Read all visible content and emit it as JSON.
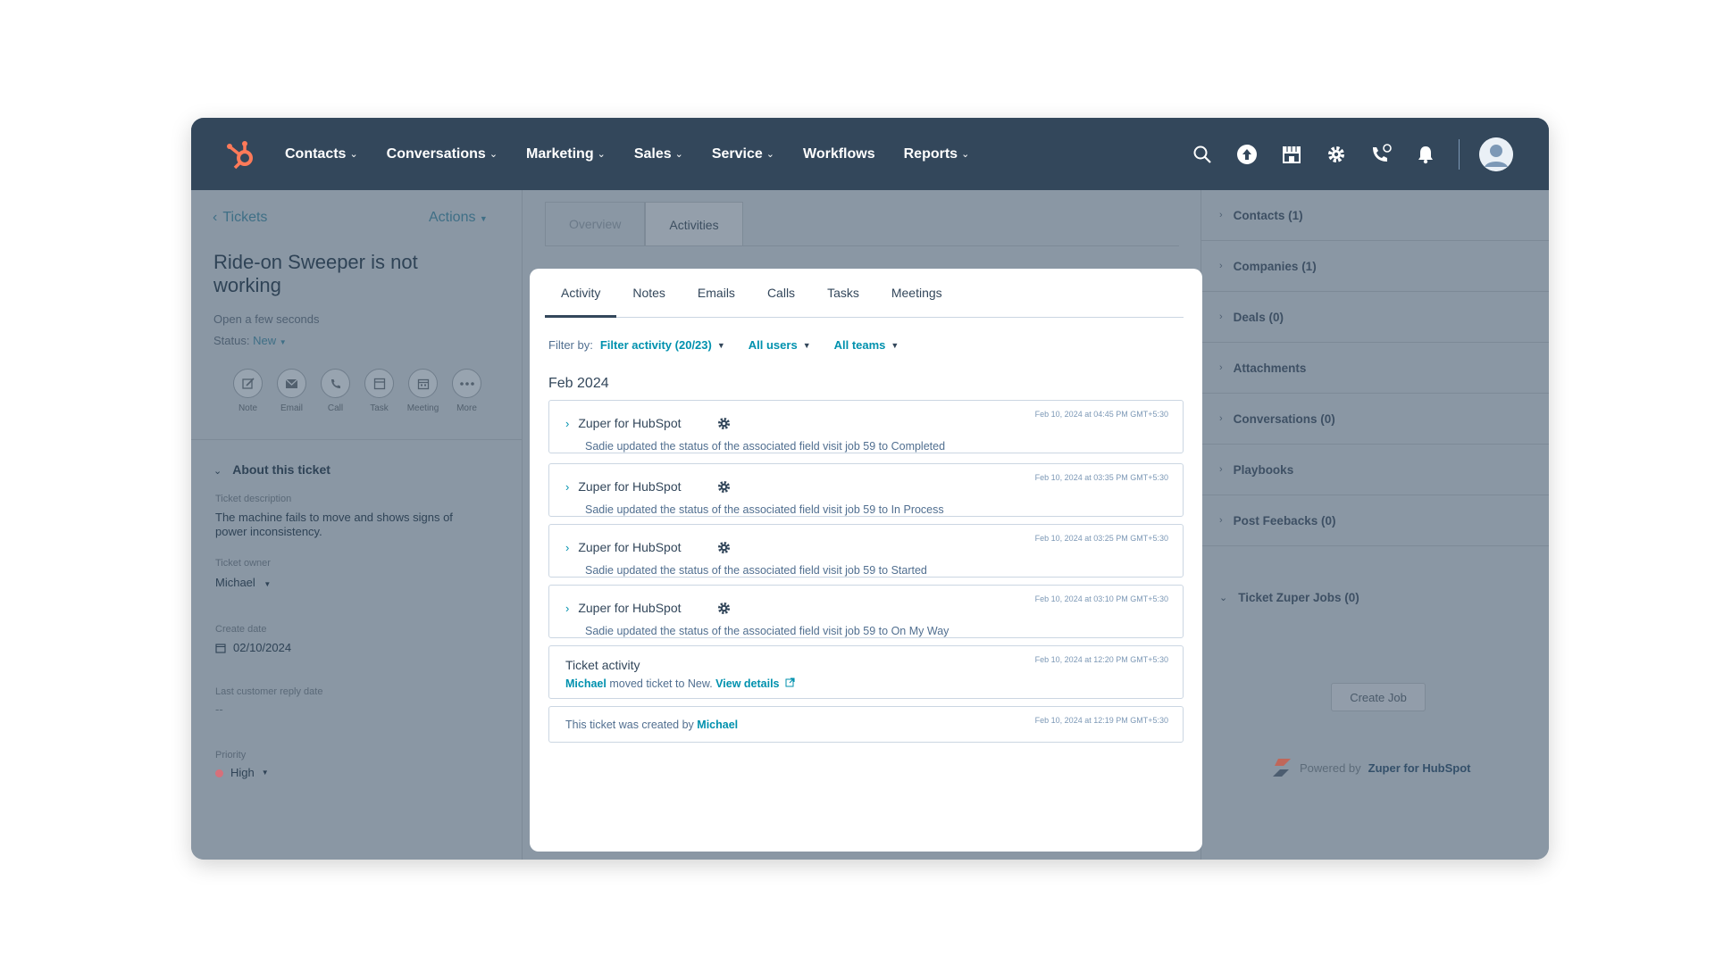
{
  "nav": {
    "items": [
      {
        "label": "Contacts",
        "dropdown": true
      },
      {
        "label": "Conversations",
        "dropdown": true
      },
      {
        "label": "Marketing",
        "dropdown": true
      },
      {
        "label": "Sales",
        "dropdown": true
      },
      {
        "label": "Service",
        "dropdown": true
      },
      {
        "label": "Workflows",
        "dropdown": false
      },
      {
        "label": "Reports",
        "dropdown": true
      }
    ],
    "icons": [
      "search-icon",
      "upgrade-icon",
      "marketplace-icon",
      "settings-icon",
      "calling-icon",
      "notifications-icon"
    ],
    "brand_color": "#ff7a59",
    "bar_color": "#33475b"
  },
  "left": {
    "back_label": "Tickets",
    "actions_label": "Actions",
    "title": "Ride-on Sweeper is not working",
    "open_text": "Open a few seconds",
    "status_label": "Status:",
    "status_value": "New",
    "quick_actions": [
      "Note",
      "Email",
      "Call",
      "Task",
      "Meeting",
      "More"
    ],
    "about_title": "About this ticket",
    "fields": {
      "description_label": "Ticket description",
      "description_value": "The machine fails to move and shows signs of power inconsistency.",
      "owner_label": "Ticket owner",
      "owner_value": "Michael",
      "create_label": "Create date",
      "create_value": "02/10/2024",
      "reply_label": "Last customer reply date",
      "reply_value": "--",
      "priority_label": "Priority",
      "priority_value": "High",
      "priority_color": "#f2545b"
    }
  },
  "middle": {
    "tabs": [
      "Overview",
      "Activities"
    ]
  },
  "card": {
    "tabs": [
      "Activity",
      "Notes",
      "Emails",
      "Calls",
      "Tasks",
      "Meetings"
    ],
    "filter_label": "Filter by:",
    "filters": [
      "Filter activity (20/23)",
      "All users",
      "All teams"
    ],
    "month": "Feb 2024",
    "entries": [
      {
        "title": "Zuper for HubSpot",
        "timestamp": "Feb 10, 2024 at 04:45 PM GMT+5:30",
        "body": "Sadie updated the status of the associated field visit job 59 to Completed"
      },
      {
        "title": "Zuper for HubSpot",
        "timestamp": "Feb 10, 2024 at 03:35 PM GMT+5:30",
        "body": "Sadie updated the status of the associated field visit job 59 to In Process"
      },
      {
        "title": "Zuper for HubSpot",
        "timestamp": "Feb 10, 2024 at 03:25 PM GMT+5:30",
        "body": "Sadie updated the status of the associated field visit job 59 to Started"
      },
      {
        "title": "Zuper for HubSpot",
        "timestamp": "Feb 10, 2024 at 03:10 PM GMT+5:30",
        "body": "Sadie updated the status of the associated field visit job 59 to On My Way"
      }
    ],
    "ticket_activity": {
      "title": "Ticket activity",
      "timestamp": "Feb 10, 2024 at 12:20 PM GMT+5:30",
      "user": "Michael",
      "text": "moved ticket to New.",
      "link": "View details"
    },
    "created": {
      "timestamp": "Feb 10, 2024 at 12:19 PM GMT+5:30",
      "text": "This ticket was created by",
      "user": "Michael"
    }
  },
  "right": {
    "sections": [
      "Contacts (1)",
      "Companies (1)",
      "Deals (0)",
      "Attachments",
      "Conversations (0)",
      "Playbooks",
      "Post Feebacks (0)"
    ],
    "jobs_title": "Ticket Zuper Jobs (0)",
    "create_job": "Create Job",
    "powered_by": "Powered by",
    "powered_brand": "Zuper for HubSpot"
  }
}
